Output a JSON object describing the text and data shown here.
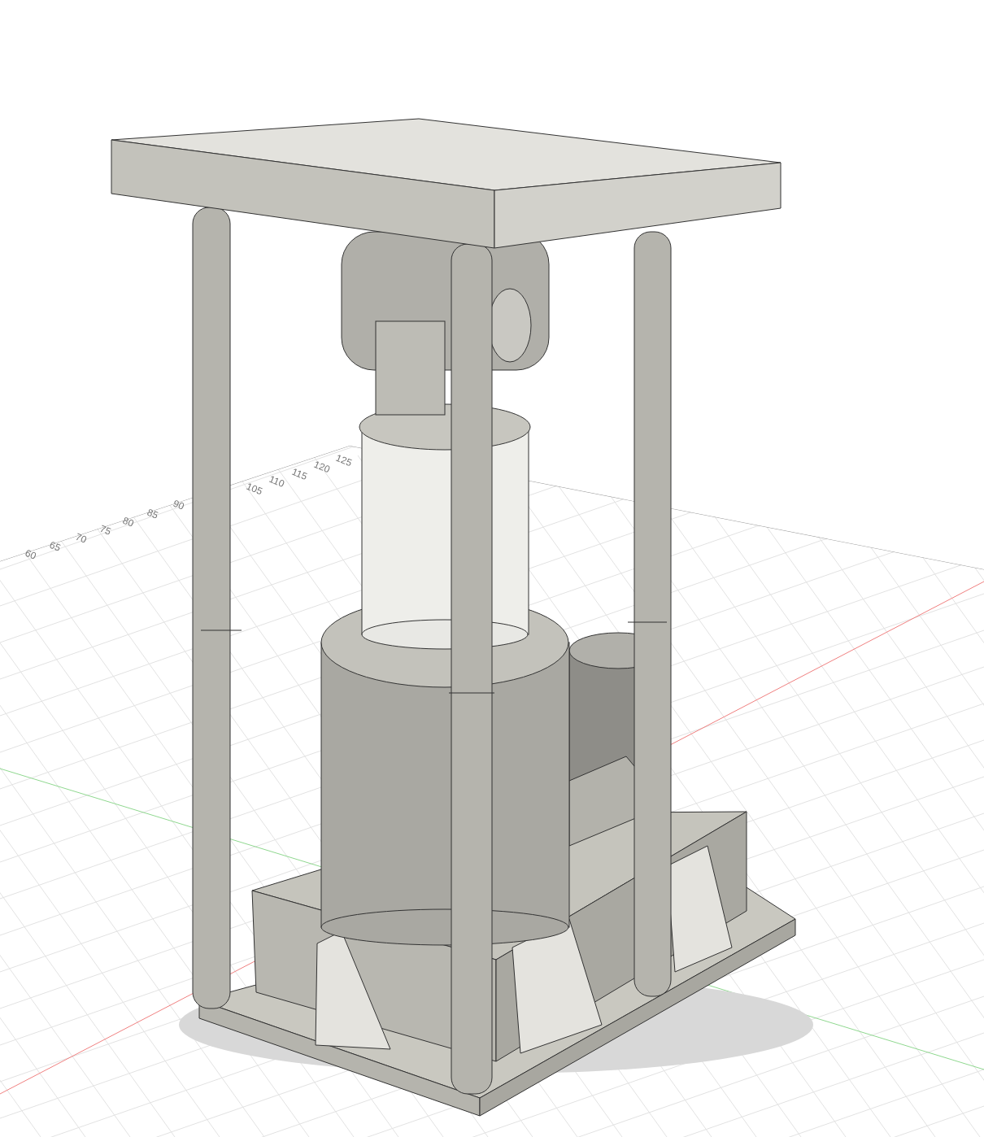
{
  "viewport": {
    "ruler_labels": [
      "60",
      "65",
      "70",
      "75",
      "80",
      "85",
      "90",
      "105",
      "110",
      "115",
      "120",
      "125"
    ]
  }
}
